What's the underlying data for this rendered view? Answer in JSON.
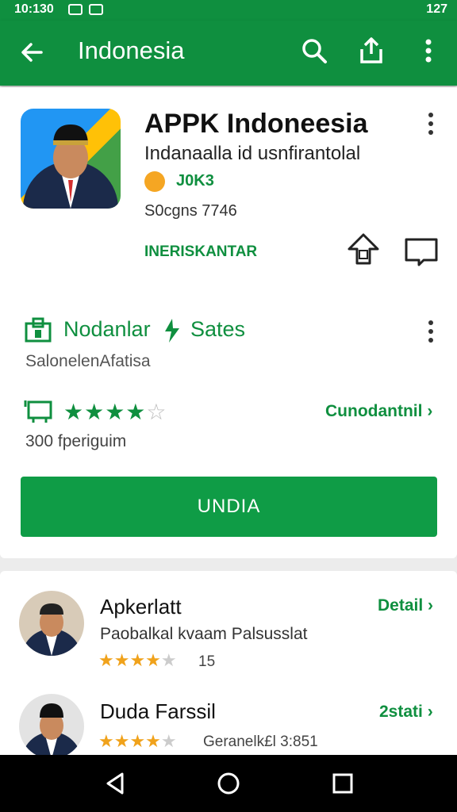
{
  "status_bar": {
    "time": "10:130",
    "right_text": "127"
  },
  "app_bar": {
    "title": "Indonesia"
  },
  "app": {
    "name": "APPK Indoneesia",
    "subtitle": "Indanaalla id usnfirantolal",
    "developer": "J0K3",
    "size": "S0cgns 7746",
    "install_link": "INERISKANTAR"
  },
  "section": {
    "title": "Nodanlar",
    "title_tag": "Sates",
    "subtitle": "SalonelenAfatisa"
  },
  "rating": {
    "value": 4,
    "max": 5,
    "link_label": "Cunodantnil",
    "count_label": "300 fperiguim"
  },
  "install_button": {
    "label": "UNDIA"
  },
  "related": [
    {
      "title": "Apkerlatt",
      "subtitle": "Paobalkal kvaam Palsusslat",
      "rating": 4.5,
      "meta": "15",
      "link": "Detail"
    },
    {
      "title": "Duda Farssil",
      "subtitle": "",
      "rating": 4,
      "meta": "Geranelk£l 3:851",
      "link": "2stati"
    }
  ],
  "colors": {
    "brand": "#0f8f3f",
    "button": "#0f9c46",
    "star": "#0f8f3f",
    "star_orange": "#f0a21b"
  },
  "icons": [
    "back-arrow-icon",
    "search-icon",
    "share-icon",
    "more-vert-icon",
    "upload-icon",
    "bookmark-icon",
    "store-icon",
    "gift-icon",
    "device-icon"
  ]
}
